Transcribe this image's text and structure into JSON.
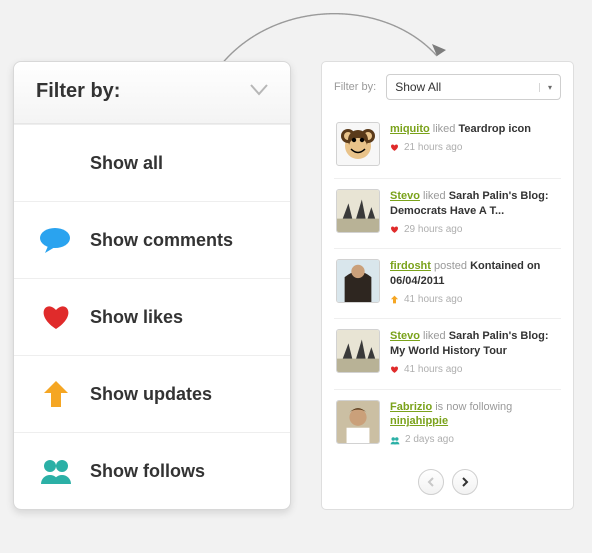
{
  "colors": {
    "comment": "#2aa3ef",
    "like": "#e02b2b",
    "update": "#f5a623",
    "follow": "#2bb0a6",
    "accent_green": "#7aa21a"
  },
  "dropdown": {
    "header": "Filter by:",
    "items": [
      {
        "label": "Show all",
        "icon": null
      },
      {
        "label": "Show comments",
        "icon": "comment"
      },
      {
        "label": "Show likes",
        "icon": "like"
      },
      {
        "label": "Show updates",
        "icon": "update"
      },
      {
        "label": "Show follows",
        "icon": "follow"
      }
    ]
  },
  "activity": {
    "filter_label": "Filter by:",
    "select_value": "Show All",
    "items": [
      {
        "avatar": "monkey",
        "user": "miquito",
        "verb_plain": "liked",
        "object": "Teardrop icon",
        "time": "21 hours ago",
        "meta_icon": "like"
      },
      {
        "avatar": "photo1",
        "user": "Stevo",
        "verb_plain": "liked",
        "object": "Sarah Palin's Blog: Democrats Have A T...",
        "time": "29 hours ago",
        "meta_icon": "like"
      },
      {
        "avatar": "photo2",
        "user": "firdosht",
        "verb_plain": "posted",
        "object": "Kontained on 06/04/2011",
        "time": "41 hours ago",
        "meta_icon": "update"
      },
      {
        "avatar": "photo1",
        "user": "Stevo",
        "verb_plain": "liked",
        "object": "Sarah Palin's Blog: My World History Tour",
        "time": "41 hours ago",
        "meta_icon": "like"
      },
      {
        "avatar": "photo3",
        "user": "Fabrizio",
        "verb_plain": "is now following",
        "object_user": "ninjahippie",
        "time": "2 days ago",
        "meta_icon": "follow"
      }
    ]
  }
}
